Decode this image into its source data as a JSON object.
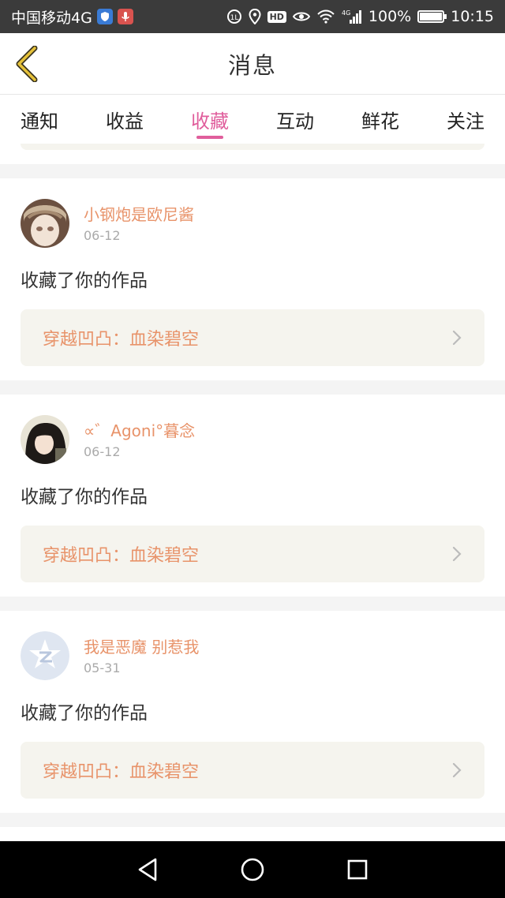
{
  "status_bar": {
    "carrier": "中国移动4G",
    "wifi_badge": "4G",
    "battery": "100%",
    "battery_level": 1.0,
    "time": "10:15"
  },
  "header": {
    "title": "消息"
  },
  "tabs": [
    {
      "label": "通知",
      "active": false
    },
    {
      "label": "收益",
      "active": false
    },
    {
      "label": "收藏",
      "active": true
    },
    {
      "label": "互动",
      "active": false
    },
    {
      "label": "鲜花",
      "active": false
    },
    {
      "label": "关注",
      "active": false
    }
  ],
  "messages": [
    {
      "user": "小钢炮是欧尼酱",
      "date": "06-12",
      "text": "收藏了你的作品",
      "work": "穿越凹凸：血染碧空",
      "avatar": "doll-avatar"
    },
    {
      "user": "∝゛Agoni°暮念",
      "date": "06-12",
      "text": "收藏了你的作品",
      "work": "穿越凹凸：血染碧空",
      "avatar": "girl-avatar"
    },
    {
      "user": "我是恶魔 别惹我",
      "date": "05-31",
      "text": "收藏了你的作品",
      "work": "穿越凹凸：血染碧空",
      "avatar": "qq-default-avatar"
    },
    {
      "user": "@",
      "avatar": "man-avatar"
    }
  ],
  "colors": {
    "accent": "#e05e9c",
    "username": "#e8936a",
    "back_arrow": "#e6c23a"
  }
}
